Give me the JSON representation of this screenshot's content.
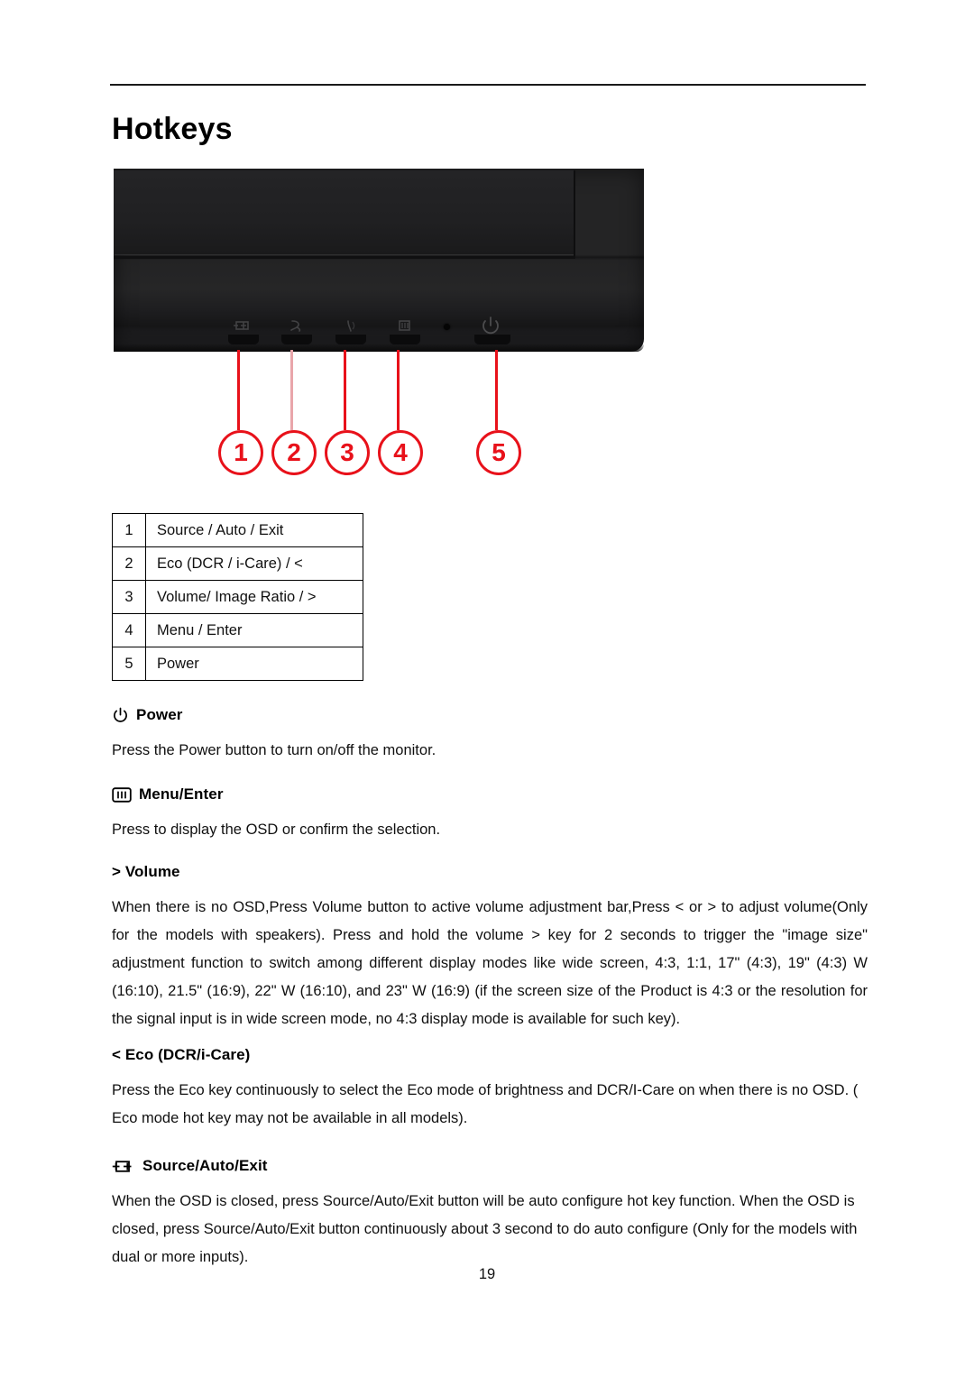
{
  "document": {
    "title": "Hotkeys",
    "page_number": "19"
  },
  "figure": {
    "name": "monitor-front-panel-photo",
    "callout_color": "#e8111a",
    "callouts": [
      {
        "number": "1",
        "glyph": "source-auto-exit-icon"
      },
      {
        "number": "2",
        "glyph": "eco-icon"
      },
      {
        "number": "3",
        "glyph": "volume-icon"
      },
      {
        "number": "4",
        "glyph": "menu-enter-icon"
      },
      {
        "number": "5",
        "glyph": "power-icon"
      }
    ]
  },
  "key_table": {
    "rows": [
      {
        "num": "1",
        "desc": "Source / Auto / Exit"
      },
      {
        "num": "2",
        "desc": "Eco (DCR / i-Care) / <"
      },
      {
        "num": "3",
        "desc": "Volume/ Image Ratio / >"
      },
      {
        "num": "4",
        "desc": "Menu / Enter"
      },
      {
        "num": "5",
        "desc": "Power"
      }
    ]
  },
  "sections": [
    {
      "id": "power",
      "icon": "power-icon",
      "heading": "Power",
      "body": "Press the Power button to turn on/off the monitor."
    },
    {
      "id": "menu-enter",
      "icon": "menu-enter-icon",
      "heading": "Menu/Enter",
      "body": "Press to display the OSD or confirm the selection."
    },
    {
      "id": "volume",
      "icon": "none",
      "heading": "> Volume",
      "body": "When there is no OSD,Press Volume button to active volume adjustment bar,Press < or > to adjust volume(Only for the models with speakers). Press and hold the volume > key for 2 seconds to trigger the \"image size\" adjustment function to switch among different display modes like wide screen, 4:3, 1:1, 17\" (4:3), 19\" (4:3) W (16:10), 21.5\" (16:9), 22\" W (16:10), and 23\" W (16:9) (if the screen size of the Product is 4:3 or the resolution for the signal input is in wide screen mode, no 4:3 display mode is available for such key)."
    },
    {
      "id": "eco",
      "icon": "none",
      "heading": "< Eco (DCR/i-Care)",
      "body": "Press the Eco key continuously to select the Eco mode of brightness and DCR/I-Care on when there is no OSD. ( Eco mode hot key may not be available in all models)."
    },
    {
      "id": "source-auto-exit",
      "icon": "source-auto-exit-icon",
      "heading": "Source/Auto/Exit",
      "body": "When the OSD is closed, press Source/Auto/Exit button will be auto configure hot key function. When the OSD is closed, press Source/Auto/Exit button continuously about 3 second to do auto configure (Only for the models with dual or more inputs)."
    }
  ]
}
